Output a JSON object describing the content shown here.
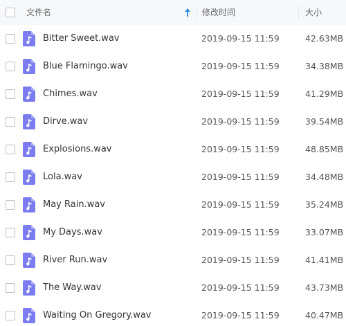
{
  "header": {
    "name_label": "文件名",
    "time_label": "修改时间",
    "size_label": "大小",
    "sort_color": "#2e8fe8"
  },
  "icon_color": "#7b7cf0",
  "files": [
    {
      "name": "Bitter Sweet.wav",
      "modified": "2019-09-15 11:59",
      "size": "42.63MB"
    },
    {
      "name": "Blue Flamingo.wav",
      "modified": "2019-09-15 11:59",
      "size": "34.38MB"
    },
    {
      "name": "Chimes.wav",
      "modified": "2019-09-15 11:59",
      "size": "41.29MB"
    },
    {
      "name": "Dirve.wav",
      "modified": "2019-09-15 11:59",
      "size": "39.54MB"
    },
    {
      "name": "Explosions.wav",
      "modified": "2019-09-15 11:59",
      "size": "48.85MB"
    },
    {
      "name": "Lola.wav",
      "modified": "2019-09-15 11:59",
      "size": "34.48MB"
    },
    {
      "name": "May Rain.wav",
      "modified": "2019-09-15 11:59",
      "size": "35.24MB"
    },
    {
      "name": "My Days.wav",
      "modified": "2019-09-15 11:59",
      "size": "33.07MB"
    },
    {
      "name": "River Run.wav",
      "modified": "2019-09-15 11:59",
      "size": "41.41MB"
    },
    {
      "name": "The Way.wav",
      "modified": "2019-09-15 11:59",
      "size": "43.73MB"
    },
    {
      "name": "Waiting On Gregory.wav",
      "modified": "2019-09-15 11:59",
      "size": "40.47MB"
    }
  ]
}
